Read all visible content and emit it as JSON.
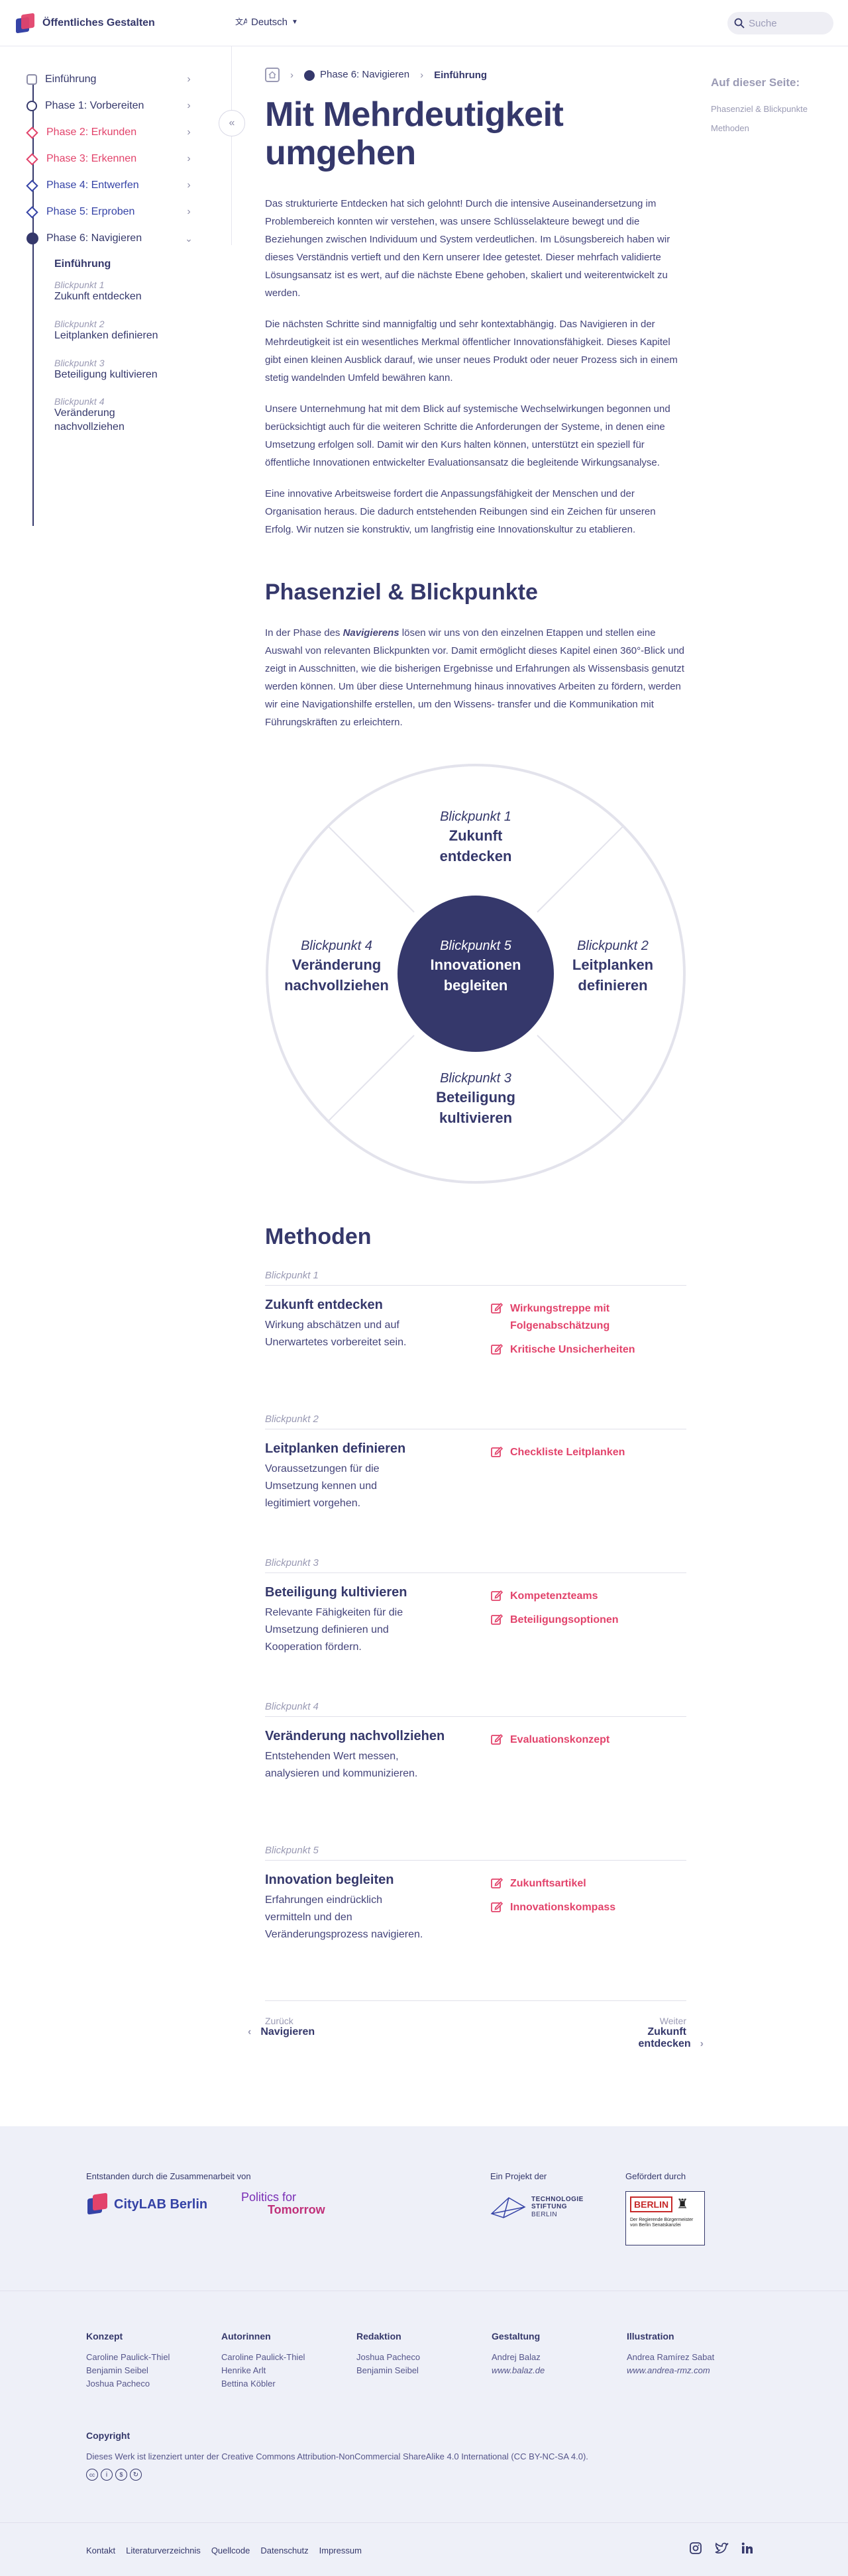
{
  "header": {
    "site_title": "Öffentliches Gestalten",
    "language": "Deutsch",
    "search_placeholder": "Suche"
  },
  "sidebar": {
    "items": [
      {
        "label": "Einführung"
      },
      {
        "label": "Phase 1: Vorbereiten"
      },
      {
        "label": "Phase 2: Erkunden"
      },
      {
        "label": "Phase 3: Erkennen"
      },
      {
        "label": "Phase 4: Entwerfen"
      },
      {
        "label": "Phase 5: Erproben"
      },
      {
        "label": "Phase 6: Navigieren"
      }
    ],
    "sub_heading": "Einführung",
    "sub_items": [
      {
        "key": "Blickpunkt 1",
        "title": "Zukunft entdecken"
      },
      {
        "key": "Blickpunkt 2",
        "title": "Leitplanken definieren"
      },
      {
        "key": "Blickpunkt 3",
        "title": "Beteiligung kultivieren"
      },
      {
        "key": "Blickpunkt 4",
        "title": "Veränderung nachvollziehen"
      }
    ]
  },
  "breadcrumb": {
    "phase": "Phase 6: Navigieren",
    "current": "Einführung"
  },
  "page": {
    "title": "Mit Mehrdeutigkeit umgehen",
    "paragraphs": [
      "Das strukturierte Entdecken hat sich gelohnt! Durch die intensive Auseinandersetzung im Problembereich konnten wir verstehen, was unsere Schlüsselakteure bewegt und die Beziehungen zwischen Individuum und System verdeutlichen. Im Lösungsbereich haben wir dieses Verständnis vertieft und den Kern unserer Idee getestet. Dieser mehrfach validierte Lösungsansatz ist es wert, auf die nächste Ebene gehoben, skaliert und weiterentwickelt zu werden.",
      "Die nächsten Schritte sind mannigfaltig und sehr kontextabhängig. Das Navigieren in der Mehrdeutigkeit ist ein wesentliches Merkmal öffentlicher Innovationsfähigkeit. Dieses Kapitel gibt einen kleinen Ausblick darauf, wie unser neues Produkt oder neuer Prozess sich in einem stetig wandelnden Umfeld bewähren kann.",
      "Unsere Unternehmung hat mit dem Blick auf systemische Wechselwirkungen begonnen und berücksichtigt auch für die weiteren Schritte die Anforderungen der Systeme, in denen eine Umsetzung erfolgen soll. Damit wir den Kurs halten können, unterstützt ein speziell für öffentliche Innovationen entwickelter Evaluationsansatz die begleitende Wirkungsanalyse.",
      "Eine innovative Arbeitsweise fordert die Anpassungsfähigkeit der Menschen und der Organisation heraus. Die dadurch entstehenden Reibungen sind ein Zeichen für unseren Erfolg. Wir nutzen sie konstruktiv, um langfristig eine Innovationskultur zu etablieren."
    ],
    "section_title": "Phasenziel & Blickpunkte",
    "section_intro_pre": "In der Phase des ",
    "section_intro_em": "Navigierens",
    "section_intro_post": " lösen wir uns von den einzelnen Etappen und stellen eine Auswahl von relevanten Blickpunkten vor. Damit ermöglicht dieses Kapitel einen 360°-Blick und zeigt in Ausschnitten, wie die bisherigen Ergebnisse und Erfahrungen als Wissensbasis genutzt werden können. Um über diese Unternehmung hinaus innovatives Arbeiten zu fördern, werden wir eine Navigationshilfe erstellen, um den Wissens- transfer und die Kommunikation mit Führungskräften zu erleichtern.",
    "methods_title": "Methoden"
  },
  "diagram": {
    "top": {
      "key": "Blickpunkt 1",
      "line1": "Zukunft",
      "line2": "entdecken"
    },
    "right": {
      "key": "Blickpunkt 2",
      "line1": "Leitplanken",
      "line2": "definieren"
    },
    "bottom": {
      "key": "Blickpunkt 3",
      "line1": "Beteiligung",
      "line2": "kultivieren"
    },
    "left": {
      "key": "Blickpunkt 4",
      "line1": "Veränderung",
      "line2": "nachvollziehen"
    },
    "center": {
      "key": "Blickpunkt 5",
      "line1": "Innovationen",
      "line2": "begleiten"
    }
  },
  "methods": [
    {
      "key": "Blickpunkt 1",
      "title": "Zukunft entdecken",
      "desc": "Wirkung abschätzen und auf Unerwartetes vorbereitet sein.",
      "links": [
        "Wirkungstreppe mit Folgenabschätzung",
        "Kritische Unsicherheiten"
      ]
    },
    {
      "key": "Blickpunkt 2",
      "title": "Leitplanken definieren",
      "desc": "Voraussetzungen für die Umsetzung kennen und legitimiert vorgehen.",
      "links": [
        "Checkliste Leitplanken"
      ]
    },
    {
      "key": "Blickpunkt 3",
      "title": "Beteiligung kultivieren",
      "desc": "Relevante Fähigkeiten für die Umsetzung definieren und Kooperation fördern.",
      "links": [
        "Kompetenzteams",
        "Beteiligungsoptionen"
      ]
    },
    {
      "key": "Blickpunkt 4",
      "title": "Veränderung nachvollziehen",
      "desc": "Entstehenden Wert messen, analysieren und kommunizieren.",
      "links": [
        "Evaluationskonzept"
      ]
    },
    {
      "key": "Blickpunkt 5",
      "title": "Innovation begleiten",
      "desc": "Erfahrungen eindrücklich vermitteln und den Veränderungsprozess navigieren.",
      "links": [
        "Zukunftsartikel",
        "Innovationskompass"
      ]
    }
  ],
  "pager": {
    "prev_label": "Zurück",
    "prev_value": "Navigieren",
    "next_label": "Weiter",
    "next_value": "Zukunft entdecken"
  },
  "toc": {
    "title": "Auf dieser Seite:",
    "items": [
      "Phasenziel & Blickpunkte",
      "Methoden"
    ]
  },
  "footer": {
    "collab_label": "Entstanden durch die Zusammenarbeit von",
    "citylab": "CityLAB Berlin",
    "pft_line1": "Politics for",
    "pft_line2": "Tomorrow",
    "project_label": "Ein Projekt der",
    "ts_line1": "TECHNOLOGIE",
    "ts_line2": "STIFTUNG",
    "ts_line3": "BERLIN",
    "funded_label": "Gefördert durch",
    "berlin": "BERLIN",
    "berlin_sub": "Der Regierende Bürgermeister von Berlin Senatskanzlei",
    "credits": [
      {
        "heading": "Konzept",
        "names": [
          "Caroline Paulick-Thiel",
          "Benjamin Seibel",
          "Joshua Pacheco"
        ]
      },
      {
        "heading": "Autorinnen",
        "names": [
          "Caroline Paulick-Thiel",
          "Henrike Arlt",
          "Bettina Köbler"
        ]
      },
      {
        "heading": "Redaktion",
        "names": [
          "Joshua Pacheco",
          "Benjamin Seibel"
        ]
      },
      {
        "heading": "Gestaltung",
        "names": [
          "Andrej Balaz",
          "www.balaz.de"
        ]
      },
      {
        "heading": "Illustration",
        "names": [
          "Andrea Ramírez Sabat",
          "www.andrea-rmz.com"
        ]
      }
    ],
    "copyright_heading": "Copyright",
    "copyright_text": "Dieses Werk ist lizenziert unter der Creative Commons Attribution-NonCommercial ShareAlike 4.0 International (CC BY-NC-SA 4.0).",
    "links": [
      "Kontakt",
      "Literaturverzeichnis",
      "Quellcode",
      "Datenschutz",
      "Impressum"
    ],
    "social_icons": [
      "instagram-icon",
      "twitter-icon",
      "linkedin-icon"
    ]
  },
  "colors": {
    "navy": "#35386b",
    "pink": "#e2436b",
    "blue": "#3543a6",
    "footer_bg": "#eef0f8"
  }
}
